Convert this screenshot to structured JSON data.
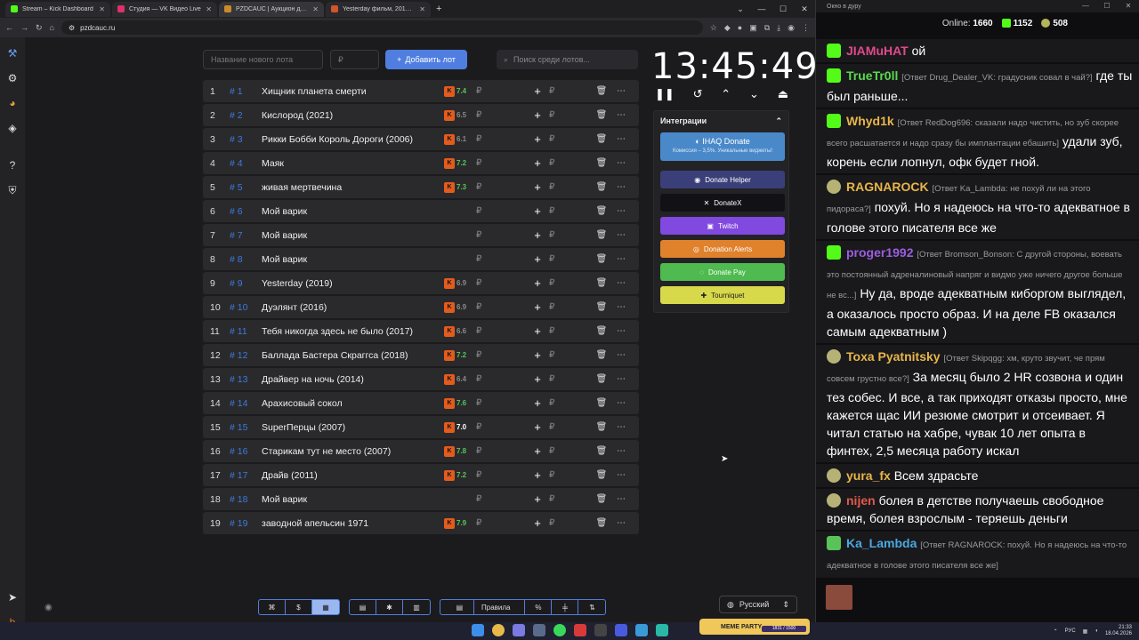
{
  "browser": {
    "tabs": [
      {
        "label": "Stream – Kick Dashboard",
        "color": "#53fc18"
      },
      {
        "label": "Студия — VK Видео Live",
        "color": "#e0306c"
      },
      {
        "label": "PZDCAUC | Аукцион для стри...",
        "color": "#cc8a2a"
      },
      {
        "label": "Yesterday фильм, 2019, дата в...",
        "color": "#d2542a"
      }
    ],
    "url": "pzdcauc.ru"
  },
  "controls": {
    "lot_name_placeholder": "Название нового лота",
    "currency_placeholder": "₽",
    "add_lot_label": "Добавить лот",
    "search_placeholder": "Поиск среди лотов..."
  },
  "lots": [
    {
      "num": "1",
      "hash": "# 1",
      "name": "Хищник планета смерти",
      "rating": "7.4",
      "rating_color": "#56c25a"
    },
    {
      "num": "2",
      "hash": "# 2",
      "name": "Кислород (2021)",
      "rating": "6.5",
      "rating_color": "#888888"
    },
    {
      "num": "3",
      "hash": "# 3",
      "name": "Рикки Бобби Король Дороги (2006)",
      "rating": "6.1",
      "rating_color": "#888888"
    },
    {
      "num": "4",
      "hash": "# 4",
      "name": "Маяк",
      "rating": "7.2",
      "rating_color": "#56c25a"
    },
    {
      "num": "5",
      "hash": "# 5",
      "name": "живая мертвечина",
      "rating": "7.3",
      "rating_color": "#56c25a"
    },
    {
      "num": "6",
      "hash": "# 6",
      "name": "Мой варик",
      "rating": "",
      "rating_color": ""
    },
    {
      "num": "7",
      "hash": "# 7",
      "name": "Мой варик",
      "rating": "",
      "rating_color": ""
    },
    {
      "num": "8",
      "hash": "# 8",
      "name": "Мой варик",
      "rating": "",
      "rating_color": ""
    },
    {
      "num": "9",
      "hash": "# 9",
      "name": "Yesterday (2019)",
      "rating": "6.9",
      "rating_color": "#888888"
    },
    {
      "num": "10",
      "hash": "# 10",
      "name": "Дуэлянт (2016)",
      "rating": "6.9",
      "rating_color": "#888888"
    },
    {
      "num": "11",
      "hash": "# 11",
      "name": " Тебя никогда здесь не было (2017)",
      "rating": "6.6",
      "rating_color": "#888888"
    },
    {
      "num": "12",
      "hash": "# 12",
      "name": "Баллада Бастера Скраггса (2018)",
      "rating": "7.2",
      "rating_color": "#56c25a"
    },
    {
      "num": "13",
      "hash": "# 13",
      "name": "Драйвер на ночь (2014)",
      "rating": "6.4",
      "rating_color": "#888888"
    },
    {
      "num": "14",
      "hash": "# 14",
      "name": "Арахисовый сокол",
      "rating": "7.6",
      "rating_color": "#56c25a"
    },
    {
      "num": "15",
      "hash": "# 15",
      "name": "SuperПерцы (2007)",
      "rating": "7.0",
      "rating_color": "#ffffff"
    },
    {
      "num": "16",
      "hash": "# 16",
      "name": "Старикам тут не место (2007)",
      "rating": "7.8",
      "rating_color": "#56c25a"
    },
    {
      "num": "17",
      "hash": "# 17",
      "name": "Драйв (2011)",
      "rating": "7.2",
      "rating_color": "#56c25a"
    },
    {
      "num": "18",
      "hash": "# 18",
      "name": "Мой варик",
      "rating": "",
      "rating_color": ""
    },
    {
      "num": "19",
      "hash": "# 19",
      "name": "заводной апельсин 1971",
      "rating": "7.9",
      "rating_color": "#56c25a"
    }
  ],
  "currency": "₽",
  "timer": {
    "value": "13:45:49"
  },
  "integrations": {
    "title": "Интеграции",
    "ihaq": {
      "label": "IHAQ Donate",
      "sub": "Комиссия – 3,5%. Уникальные виджеты!"
    },
    "buttons": [
      {
        "label": "Donate Helper",
        "color": "#3a3f7a"
      },
      {
        "label": "DonateX",
        "color": "#111116"
      },
      {
        "label": "Twitch",
        "color": "#8149e0"
      },
      {
        "label": "Donation Alerts",
        "color": "#e0812c"
      },
      {
        "label": "Donate Pay",
        "color": "#4fba4f"
      },
      {
        "label": "Tourniquet",
        "color": "#d8d94a"
      }
    ]
  },
  "bottom": {
    "rules_label": "Правила",
    "language": "Русский"
  },
  "chat": {
    "window_title": "Окно в дуру",
    "online_label": "Online:",
    "online_count": "1660",
    "kick_count": "1152",
    "other_count": "508",
    "messages": [
      {
        "badge": "k",
        "user": "JIAMuHAT",
        "color": "#e04a8a",
        "reply": "",
        "text": "ой"
      },
      {
        "badge": "k",
        "user": "TrueTr0ll",
        "color": "#5ad84d",
        "reply": "[Ответ Drug_Dealer_VK: градусник совал в чай?]",
        "text": "где ты был раньше..."
      },
      {
        "badge": "k",
        "user": "Whyd1k",
        "color": "#e8b54a",
        "reply": "[Ответ RedDog696: сказали надо чистить, но зуб скорее всего расшатается и надо сразу бы имплантации ебашить]",
        "text": "удали зуб, корень если лопнул, офк будет гной."
      },
      {
        "badge": "p",
        "user": "RAGNAROCK",
        "color": "#e8b54a",
        "reply": "[Ответ Ka_Lambda: не похуй ли на этого пидораса?]",
        "text": "похуй. Но я надеюсь на что-то адекватное в голове этого писателя все же"
      },
      {
        "badge": "k",
        "user": "proger1992",
        "color": "#9c5de0",
        "reply": "[Ответ Bromson_Bonson: С другой стороны, воевать это постоянный адреналиновый напряг и видмо уже ничего другое больше не вс...]",
        "text": "Ну да, вроде адекватным киборгом выглядел, а оказалось просто образ. И на деле FB оказался самым адекватным )"
      },
      {
        "badge": "p",
        "user": "Toxa Pyatnitsky",
        "color": "#e8b54a",
        "reply": "[Ответ Skipqgg: хм, круто звучит, че прям совсем грустно все?]",
        "text": "За месяц было 2 HR созвона и один тез собес. И все, а так приходят отказы просто, мне кажется щас ИИ резюме смотрит и отсеивает. Я читал статью на хабре, чувак 10 лет опыта в финтех, 2,5 месяца работу искал"
      },
      {
        "badge": "p",
        "user": "yura_fx",
        "color": "#e8b54a",
        "reply": "",
        "text": "Всем здрасьте"
      },
      {
        "badge": "p",
        "user": "nijen",
        "color": "#e05a4a",
        "reply": "",
        "text": "болея в детстве получаешь свободное время, болея взрослым - теряешь деньги"
      },
      {
        "badge": "s",
        "user": "Ka_Lambda",
        "color": "#4aa8e0",
        "reply": "[Ответ RAGNAROCK: похуй. Но я надеюсь на что-то адекватное в голове этого писателя все же]",
        "text": ""
      }
    ]
  },
  "overlay": {
    "meme_label": "MEME PARTY",
    "meme_progress": "1831 / 1500"
  },
  "taskbar": {
    "lang": "РУС",
    "time": "21:33",
    "date": "18.04.2026"
  }
}
